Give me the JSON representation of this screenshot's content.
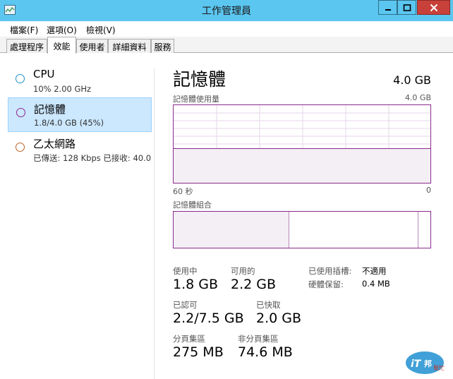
{
  "window": {
    "title": "工作管理員"
  },
  "menu": {
    "items": [
      "檔案(F)",
      "選項(O)",
      "檢視(V)"
    ]
  },
  "tabs": [
    "處理程序",
    "效能",
    "使用者",
    "詳細資料",
    "服務"
  ],
  "sidebar": {
    "items": [
      {
        "title": "CPU",
        "sub": "10%  2.00 GHz",
        "color": "#1e90c8"
      },
      {
        "title": "記憶體",
        "sub": "1.8/4.0 GB (45%)",
        "color": "#8b2a8b"
      },
      {
        "title": "乙太網路",
        "sub": "已傳送: 128 Kbps 已接收: 40.0",
        "color": "#b8632b"
      }
    ]
  },
  "main": {
    "title": "記憶體",
    "total": "4.0 GB",
    "usage_label": "記憶體使用量",
    "usage_max": "4.0 GB",
    "time_left": "60 秒",
    "time_right": "0",
    "usage_fraction": 0.45,
    "composition_label": "記憶體組合",
    "composition": {
      "in_use_fraction": 0.45,
      "standby_fraction": 0.5
    },
    "stats": {
      "in_use_label": "使用中",
      "in_use_value": "1.8 GB",
      "available_label": "可用的",
      "available_value": "2.2 GB",
      "committed_label": "已認可",
      "committed_value": "2.2/7.5 GB",
      "cached_label": "已快取",
      "cached_value": "2.0 GB",
      "paged_label": "分頁集區",
      "paged_value": "275 MB",
      "nonpaged_label": "非分頁集區",
      "nonpaged_value": "74.6 MB",
      "slots_label": "已使用插槽:",
      "slots_value": "不適用",
      "reserved_label": "硬體保留:",
      "reserved_value": "0.4 MB"
    }
  },
  "watermark": {
    "text": "iT邦幫忙"
  },
  "colors": {
    "titlebar": "#5bc6f0",
    "close": "#c7413a",
    "memory": "#8b2a8b",
    "selected": "#cce8ff"
  }
}
